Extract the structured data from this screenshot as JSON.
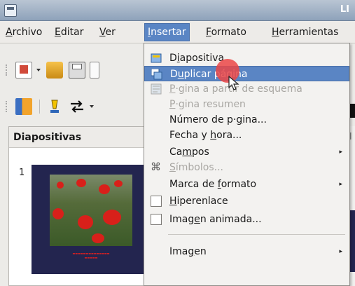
{
  "window": {
    "title": "LI"
  },
  "menubar": {
    "items": [
      {
        "label": "Archivo",
        "u": "A",
        "rest": "rchivo"
      },
      {
        "label": "Editar",
        "u": "E",
        "rest": "ditar"
      },
      {
        "label": "Ver",
        "u": "V",
        "rest": "er"
      },
      {
        "label": "Insertar",
        "u": "I",
        "rest": "nsertar"
      },
      {
        "label": "Formato",
        "u": "F",
        "rest": "ormato"
      },
      {
        "label": "Herramientas",
        "u": "H",
        "rest": "erramientas"
      }
    ],
    "active": "Insertar"
  },
  "slides_panel": {
    "title": "Diapositivas",
    "slide_number": "1",
    "right_fragment": "ol"
  },
  "insert_menu": {
    "items": [
      {
        "label": "Diapositiva",
        "pre": "D",
        "u": "i",
        "post": "apositiva",
        "state": "normal",
        "icon": "slide-icon"
      },
      {
        "label": "Duplicar página",
        "pre": "D",
        "u": "u",
        "post": "plicar página",
        "state": "highlighted",
        "icon": "duplicate-slide-icon"
      },
      {
        "label": "P·gina a partir de esquema",
        "pre": "",
        "u": "P",
        "post": "·gina a partir de esquema",
        "state": "disabled",
        "icon": "outline-slide-icon"
      },
      {
        "label": "P·gina resumen",
        "pre": "",
        "u": "P",
        "post": "·gina resumen",
        "state": "disabled"
      },
      {
        "label": "Número de p·gina...",
        "pre": "Número de p·",
        "u": "g",
        "post": "ina...",
        "state": "normal"
      },
      {
        "label": "Fecha y hora...",
        "pre": "Fecha y ",
        "u": "h",
        "post": "ora...",
        "state": "normal"
      },
      {
        "label": "Campos",
        "pre": "Ca",
        "u": "m",
        "post": "pos",
        "state": "normal",
        "submenu": true
      },
      {
        "label": "Símbolos...",
        "pre": "",
        "u": "S",
        "post": "ímbolos...",
        "state": "disabled",
        "icon": "symbols-icon"
      },
      {
        "label": "Marca de formato",
        "pre": "Marca de ",
        "u": "f",
        "post": "ormato",
        "state": "normal",
        "submenu": true
      },
      {
        "label": "Hiperenlace",
        "pre": "",
        "u": "H",
        "post": "iperenlace",
        "state": "normal",
        "checkbox": true
      },
      {
        "label": "Imagen animada...",
        "pre": "Imag",
        "u": "e",
        "post": "n animada...",
        "state": "normal",
        "checkbox": true
      },
      {
        "label": "Imagen",
        "pre": "Ima",
        "u": "g",
        "post": "en",
        "state": "normal",
        "submenu": true
      }
    ],
    "submenu_glyph": "▸"
  },
  "colors": {
    "highlight": "#5a85c4",
    "slide_bg": "#23254f",
    "cursor_halo": "#eb4646"
  }
}
